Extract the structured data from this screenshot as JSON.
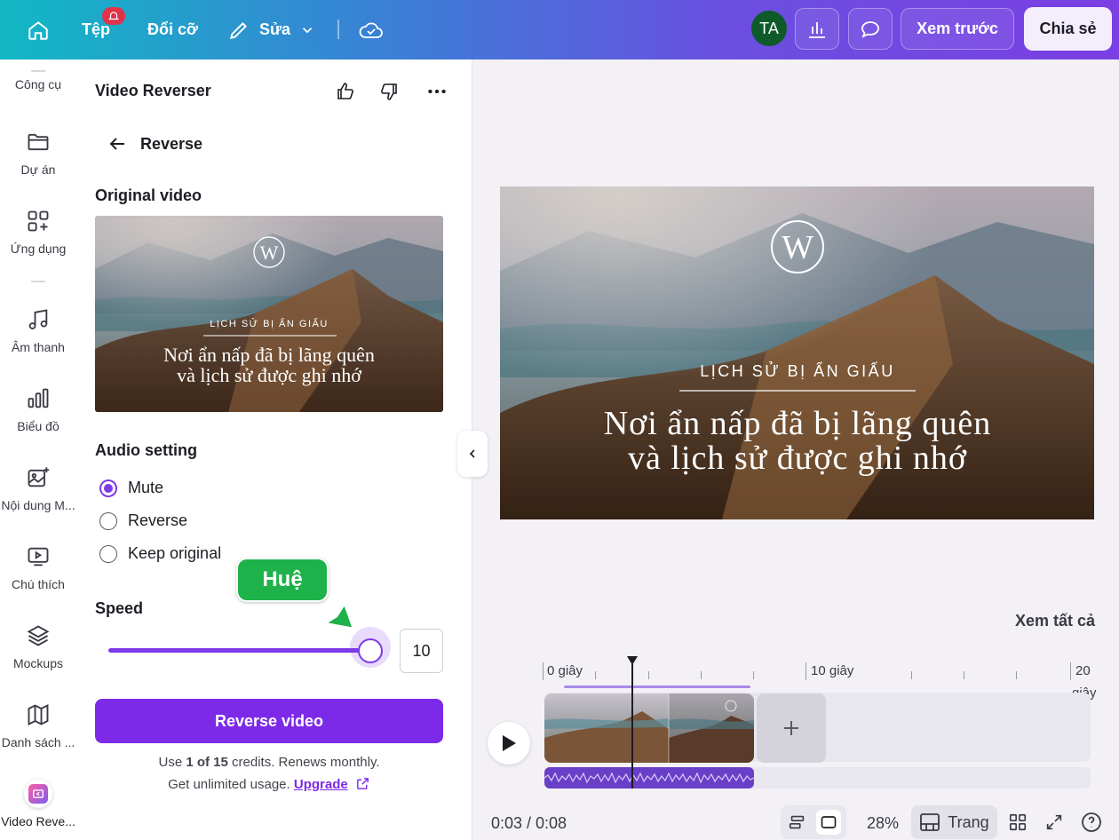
{
  "topbar": {
    "file_label": "Tệp",
    "resize_label": "Đổi cỡ",
    "edit_label": "Sửa",
    "avatar_initials": "TA",
    "preview_label": "Xem trước",
    "share_label": "Chia sẻ"
  },
  "rail": {
    "items": [
      {
        "label": "Công cụ",
        "icon": "tools-icon"
      },
      {
        "label": "Dự án",
        "icon": "folder-icon"
      },
      {
        "label": "Ứng dụng",
        "icon": "apps-icon"
      },
      {
        "label": "Âm thanh",
        "icon": "music-note-icon"
      },
      {
        "label": "Biểu đồ",
        "icon": "bar-chart-icon"
      },
      {
        "label": "Nội dung M...",
        "icon": "magic-image-icon"
      },
      {
        "label": "Chú thích",
        "icon": "captions-icon"
      },
      {
        "label": "Mockups",
        "icon": "layers-icon"
      },
      {
        "label": "Danh sách ...",
        "icon": "map-icon"
      },
      {
        "label": "Video Reve...",
        "icon": "video-reverser-app-icon"
      }
    ]
  },
  "panel": {
    "title": "Video Reverser",
    "back_label": "Reverse",
    "original_video_label": "Original video",
    "audio_setting_label": "Audio setting",
    "audio_options": [
      "Mute",
      "Reverse",
      "Keep original"
    ],
    "audio_selected": "Mute",
    "speed_label": "Speed",
    "speed_value": "10",
    "speed_fraction": 1.0,
    "reverse_button_label": "Reverse video",
    "credits_prefix": "Use ",
    "credits_strong": "1 of 15",
    "credits_suffix": " credits. Renews monthly.",
    "unlimited_text": "Get unlimited usage. ",
    "upgrade_label": "Upgrade"
  },
  "design": {
    "subtitle": "LỊCH SỬ BỊ ẨN GIẤU",
    "headline_line1": "Nơi ẩn nấp đã bị lãng quên",
    "headline_line2": "và lịch sử được ghi nhớ",
    "logo_letter": "W"
  },
  "collaborator_tag": "Huệ",
  "see_all_label": "Xem tất cả",
  "timeline": {
    "tick_0": "0 giây",
    "tick_10": "10 giây",
    "tick_20": "20",
    "tick_20_unit": "giây"
  },
  "bottombar": {
    "time": "0:03 / 0:08",
    "zoom": "28%",
    "pages_label": "Trang"
  },
  "colors": {
    "accent": "#7d2ae8",
    "tag_green": "#1db24a",
    "badge_red": "#e0324a"
  }
}
